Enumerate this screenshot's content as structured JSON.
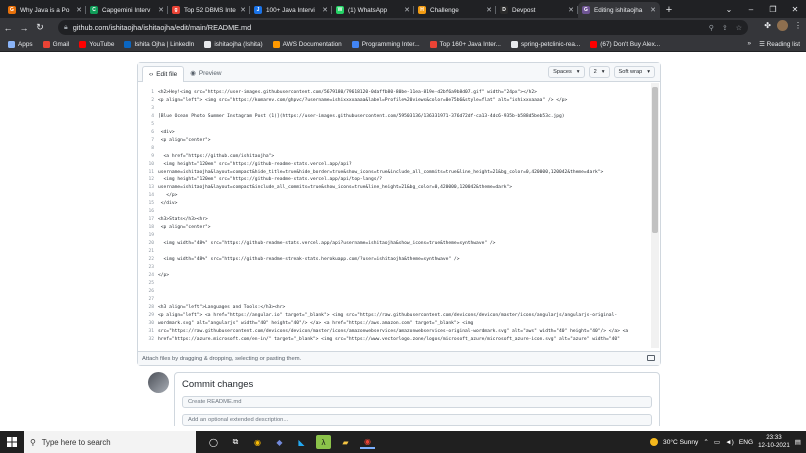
{
  "browser": {
    "tabs": [
      {
        "label": "Why Java is a Po",
        "color": "#e8710a",
        "glyph": "G",
        "active": false
      },
      {
        "label": "Capgemini Interv",
        "color": "#0f9d58",
        "glyph": "C",
        "active": false
      },
      {
        "label": "Top 52 DBMS Inte",
        "color": "#ea4335",
        "glyph": "g",
        "active": false
      },
      {
        "label": "100+ Java Intervi",
        "color": "#1a73e8",
        "glyph": "J",
        "active": false
      },
      {
        "label": "(1) WhatsApp",
        "color": "#25d366",
        "glyph": "W",
        "active": false
      },
      {
        "label": "Challenge",
        "color": "#f39c12",
        "glyph": "H",
        "active": false
      },
      {
        "label": "Devpost",
        "color": "#2b2b2b",
        "glyph": "D",
        "active": false
      },
      {
        "label": "Editing ishitaojha",
        "color": "#6e5494",
        "glyph": "G",
        "active": true
      }
    ],
    "new_tab": "+",
    "url": "github.com/ishitaojha/ishitaojha/edit/main/README.md",
    "bookmarks": [
      {
        "label": "Apps",
        "color": "#8ab4f8"
      },
      {
        "label": "Gmail",
        "color": "#ea4335"
      },
      {
        "label": "YouTube",
        "color": "#ff0000"
      },
      {
        "label": "Ishita Ojha | LinkedIn",
        "color": "#0a66c2"
      },
      {
        "label": "ishitaojha (Ishita)",
        "color": "#e8eaed"
      },
      {
        "label": "AWS Documentation",
        "color": "#ff9900"
      },
      {
        "label": "Programming Inter...",
        "color": "#4285f4"
      },
      {
        "label": "Top 160+ Java Inter...",
        "color": "#ea4335"
      },
      {
        "label": "spring-petclinic-rea...",
        "color": "#e8eaed"
      },
      {
        "label": "(67) Don't Buy Alex...",
        "color": "#ff0000"
      }
    ],
    "more_bookmarks": "»",
    "reading_list": "Reading list"
  },
  "editor": {
    "tab_edit": "Edit file",
    "tab_preview": "Preview",
    "indent_mode": "Spaces",
    "indent_size": "2",
    "wrap_mode": "Soft wrap",
    "lines": [
      {
        "n": "1",
        "text": "<h2>Hey!<img src=\"https://user-images.githubusercontent.com/5679180/79618120-0daffb80-80be-11ea-819e-d2bf6a9b8d07.gif\" width=\"24px\"></h2>"
      },
      {
        "n": "2",
        "text": "<p align=\"left\"> <img src=\"https://komarev.com/ghpvc/?username=ishixxxxaaaa&label=Profile%20views&color=0e75b6&style=flat\" alt=\"ishixxxaaaa\" /> </p>"
      },
      {
        "n": "3",
        "text": ""
      },
      {
        "n": "4",
        "text": "[Blue Ocean Photo Summer Instagram Post (1)](https://user-images.githubusercontent.com/59503136/136331971-376d72df-ca13-4dc6-935b-b588d5beb53c.jpg)"
      },
      {
        "n": "5",
        "text": ""
      },
      {
        "n": "6",
        "text": " <div>"
      },
      {
        "n": "7",
        "text": " <p align=\"center\">"
      },
      {
        "n": "8",
        "text": ""
      },
      {
        "n": "9",
        "text": "  <a href=\"https://github.com/ishitaojha\">"
      },
      {
        "n": "10",
        "text": "  <img height=\"120em\" src=\"https://github-readme-stats.vercel.app/api?"
      },
      {
        "n": "11",
        "text": "username=ishitaojha&layout=compact&hide_title=true&hide_border=true&show_icons=true&include_all_commits=true&line_height=21&bg_color=0,420000,120042&theme=dark\">"
      },
      {
        "n": "12",
        "text": "  <img height=\"120em\" src=\"https://github-readme-stats.vercel.app/api/top-langs/?"
      },
      {
        "n": "13",
        "text": "username=ishitaojha&layout=compact&include_all_commits=true&show_icons=true&line_height=21&bg_color=0,420000,120042&theme=dark\">"
      },
      {
        "n": "14",
        "text": "   </p>"
      },
      {
        "n": "15",
        "text": " </div>"
      },
      {
        "n": "16",
        "text": ""
      },
      {
        "n": "17",
        "text": "<h3>Stats</h3><hr>"
      },
      {
        "n": "18",
        "text": " <p align=\"center\">"
      },
      {
        "n": "19",
        "text": ""
      },
      {
        "n": "20",
        "text": "  <img width=\"48%\" src=\"https://github-readme-stats.vercel.app/api?username=ishitaojha&show_icons=true&theme=synthwave\" />"
      },
      {
        "n": "21",
        "text": ""
      },
      {
        "n": "22",
        "text": "  <img width=\"48%\" src=\"https://github-readme-streak-stats.herokuapp.com/?user=ishitaojha&theme=synthwave\" />"
      },
      {
        "n": "23",
        "text": ""
      },
      {
        "n": "24",
        "text": "</p>"
      },
      {
        "n": "25",
        "text": ""
      },
      {
        "n": "26",
        "text": ""
      },
      {
        "n": "27",
        "text": ""
      },
      {
        "n": "28",
        "text": "<h3 align=\"left\">Languages and Tools:</h3><hr>"
      },
      {
        "n": "29",
        "text": "<p align=\"left\"> <a href=\"https://angular.io\" target=\"_blank\"> <img src=\"https://raw.githubusercontent.com/devicons/devicon/master/icons/angularjs/angularjs-original-"
      },
      {
        "n": "30",
        "text": "wordmark.svg\" alt=\"angularjs\" width=\"40\" height=\"40\"/> </a> <a href=\"https://aws.amazon.com\" target=\"_blank\"> <img"
      },
      {
        "n": "31",
        "text": "src=\"https://raw.githubusercontent.com/devicons/devicon/master/icons/amazonwebservices/amazonwebservices-original-wordmark.svg\" alt=\"aws\" width=\"40\" height=\"40\"/> </a> <a"
      },
      {
        "n": "32",
        "text": "href=\"https://azure.microsoft.com/en-in/\" target=\"_blank\"> <img src=\"https://www.vectorlogo.zone/logos/microsoft_azure/microsoft_azure-icon.svg\" alt=\"azure\" width=\"40\""
      }
    ],
    "footer_hint": "Attach files by dragging & dropping, selecting or pasting them."
  },
  "commit": {
    "title": "Commit changes",
    "summary_placeholder": "Create README.md",
    "description_placeholder": "Add an optional extended description..."
  },
  "taskbar": {
    "search_placeholder": "Type here to search",
    "weather": "30°C  Sunny",
    "language": "ENG",
    "time": "23:33",
    "date": "12-10-2021"
  }
}
